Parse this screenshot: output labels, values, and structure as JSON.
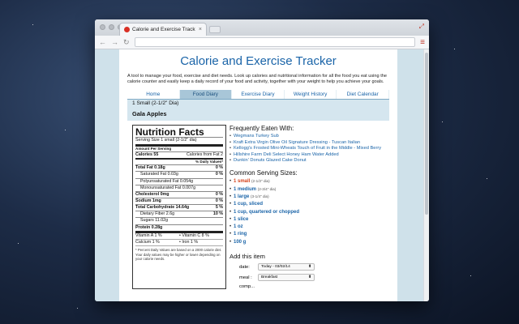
{
  "browser": {
    "tab_title": "Calorie and Exercise Track",
    "tab_close": "×"
  },
  "page": {
    "title": "Calorie and Exercise Tracker",
    "intro": "A tool to manage your food, exercise and diet needs. Look up calories and nutritional information for all the food you eat using the calorie counter and easily keep a daily record of your food and activity, together with your weight to help you achieve your goals.",
    "nav": [
      {
        "label": "Home"
      },
      {
        "label": "Food Diary"
      },
      {
        "label": "Exercise Diary"
      },
      {
        "label": "Weight History"
      },
      {
        "label": "Diet Calendar"
      }
    ],
    "active_nav": "Food Diary"
  },
  "food": {
    "serving_line": "1 Small (2-1/2\" Dia)",
    "name": "Gala Apples"
  },
  "nutrition": {
    "title": "Nutrition Facts",
    "serving_size": "Serving Size 1 small (2-1/2\" dia)",
    "amount_per_serving": "Amount Per Serving",
    "calories_label": "Calories 55",
    "calories_fat": "Calories from Fat 2",
    "dv_header": "% Daily Values*",
    "rows": [
      {
        "label": "Total Fat 0.18g",
        "dv": "0 %",
        "style": "bold"
      },
      {
        "label": "Saturated Fat 0.03g",
        "dv": "0 %",
        "style": "indent"
      },
      {
        "label": "Polyunsaturated Fat 0.054g",
        "dv": "",
        "style": "indent"
      },
      {
        "label": "Monounsaturated Fat 0.007g",
        "dv": "",
        "style": "indent"
      },
      {
        "label": "Cholesterol 0mg",
        "dv": "0 %",
        "style": "bold"
      },
      {
        "label": "Sodium 1mg",
        "dv": "0 %",
        "style": "bold"
      },
      {
        "label": "Total Carbohydrate 14.64g",
        "dv": "5 %",
        "style": "bold"
      },
      {
        "label": "Dietary Fiber 2.6g",
        "dv": "10 %",
        "style": "indent"
      },
      {
        "label": "Sugars 11.02g",
        "dv": "",
        "style": "indent"
      },
      {
        "label": "Protein 0.28g",
        "dv": "",
        "style": "bold"
      }
    ],
    "vitamins": [
      "Vitamin A 1 %",
      "•  Vitamin C 8 %",
      "Calcium 1 %",
      "•  Iron 1 %"
    ],
    "footnote": "* Percent Daily Values are based on a 2000 calorie diet. Your daily values may be higher or lower depending on your calorie needs."
  },
  "frequent": {
    "heading": "Frequently Eaten With:",
    "items": [
      "Wegmans Turkey Sub",
      "Kraft Extra Virgin Olive Oil Signature Dressing - Tuscan Italian",
      "Kellogg's Frosted Mini-Wheats Touch of Fruit in the Middle - Mixed Berry",
      "Hillshire Farm Deli Select Honey Ham Water Added",
      "Dunkin' Donuts Glazed Cake Donut"
    ]
  },
  "servings": {
    "heading": "Common Serving Sizes:",
    "items": [
      {
        "amount": "1 small",
        "note": "(2-1/2\" dia)",
        "selected": true
      },
      {
        "amount": "1 medium",
        "note": "(2-3/4\" dia)",
        "selected": false
      },
      {
        "amount": "1 large",
        "note": "(3-1/4\" dia)",
        "selected": false
      },
      {
        "amount": "1 cup, sliced",
        "note": "",
        "selected": false
      },
      {
        "amount": "1 cup, quartered or chopped",
        "note": "",
        "selected": false
      },
      {
        "amount": "1 slice",
        "note": "",
        "selected": false
      },
      {
        "amount": "1 oz",
        "note": "",
        "selected": false
      },
      {
        "amount": "1 ring",
        "note": "",
        "selected": false
      },
      {
        "amount": "100 g",
        "note": "",
        "selected": false
      }
    ]
  },
  "add_item": {
    "heading": "Add this item",
    "date_label": "date:",
    "date_value": "Today - 03/02/14",
    "meal_label": "meal :",
    "meal_value": "Breakfast",
    "third_label": "comp..."
  }
}
